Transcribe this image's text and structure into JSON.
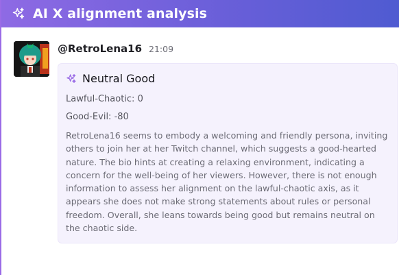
{
  "app": {
    "title": "AI X alignment analysis",
    "header_icon": "sparkles-icon"
  },
  "post": {
    "username": "@RetroLena16",
    "time": "21:09",
    "avatar": "anime-avatar-green-hair"
  },
  "analysis": {
    "icon": "sparkles-icon",
    "alignment": "Neutral Good",
    "lawful_chaotic_label": "Lawful-Chaotic:",
    "lawful_chaotic_value": "0",
    "good_evil_label": "Good-Evil:",
    "good_evil_value": "-80",
    "description": "RetroLena16 seems to embody a welcoming and friendly persona, inviting others to join her at her Twitch channel, which suggests a good-hearted nature. The bio hints at creating a relaxing environment, indicating a concern for the well-being of her viewers. However, there is not enough information to assess her alignment on the lawful-chaotic axis, as it appears she does not make strong statements about rules or personal freedom. Overall, she leans towards being good but remains neutral on the chaotic side."
  },
  "colors": {
    "header_start": "#8e6ae4",
    "header_end": "#4f5bd1",
    "card_bg": "#f5f2fd",
    "accent": "#9a6be6"
  }
}
